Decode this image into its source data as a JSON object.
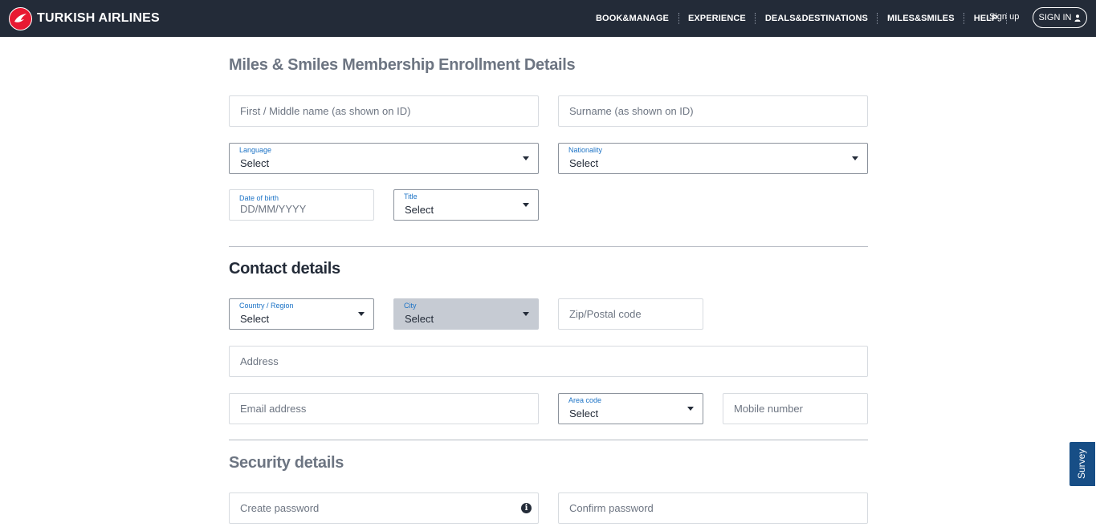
{
  "header": {
    "brand": "TURKISH AIRLINES",
    "nav": [
      "BOOK&MANAGE",
      "EXPERIENCE",
      "DEALS&DESTINATIONS",
      "MILES&SMILES",
      "HELP"
    ],
    "signup": "Sign up",
    "signin": "SIGN IN",
    "signin_icon": "user-icon",
    "brand_color": "#e81932",
    "bar_color": "#232b38"
  },
  "enrollment": {
    "title": "Miles & Smiles Membership Enrollment Details",
    "first_name_placeholder": "First / Middle name (as shown on ID)",
    "surname_placeholder": "Surname (as shown on ID)",
    "language": {
      "label": "Language",
      "value": "Select"
    },
    "nationality": {
      "label": "Nationality",
      "value": "Select"
    },
    "dob": {
      "label": "Date of birth",
      "placeholder": "DD/MM/YYYY"
    },
    "title_select": {
      "label": "Title",
      "value": "Select"
    }
  },
  "contact": {
    "heading": "Contact details",
    "country": {
      "label": "Country / Region",
      "value": "Select"
    },
    "city": {
      "label": "City",
      "value": "Select"
    },
    "zip_placeholder": "Zip/Postal code",
    "address_placeholder": "Address",
    "email_placeholder": "Email address",
    "area_code": {
      "label": "Area code",
      "value": "Select"
    },
    "mobile_placeholder": "Mobile number"
  },
  "security": {
    "heading": "Security details",
    "password_placeholder": "Create password",
    "password_info_icon": "info-icon",
    "confirm_placeholder": "Confirm password"
  },
  "survey": {
    "label": "Survey"
  }
}
